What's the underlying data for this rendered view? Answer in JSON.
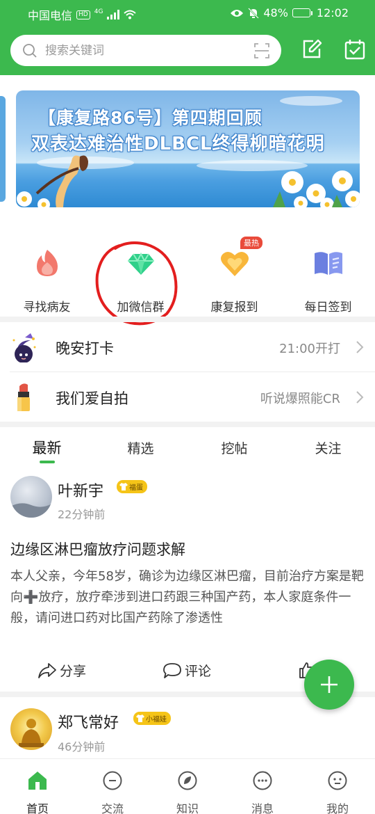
{
  "status_bar": {
    "carrier": "中国电信",
    "hd": "HD",
    "network": "4G",
    "battery": "48%",
    "battery_level": 0.48,
    "time": "12:02"
  },
  "header": {
    "search_placeholder": "搜索关键词",
    "icons": [
      "search-icon",
      "scan-icon",
      "edit-icon",
      "calendar-check-icon"
    ],
    "accent_color": "#3cb94e"
  },
  "banner": {
    "line1": "【康复路86号】第四期回顾",
    "line2": "双表达难治性DLBCL终得柳暗花明"
  },
  "quick_actions": [
    {
      "label": "寻找病友",
      "icon": "flame-icon"
    },
    {
      "label": "加微信群",
      "icon": "diamond-icon"
    },
    {
      "label": "康复报到",
      "icon": "heart-icon",
      "badge": "最热"
    },
    {
      "label": "每日签到",
      "icon": "book-icon"
    }
  ],
  "rows": [
    {
      "title": "晚安打卡",
      "value": "21:00开打",
      "icon": "moon-icon"
    },
    {
      "title": "我们爱自拍",
      "value": "听说爆照能CR",
      "icon": "lipstick-icon"
    }
  ],
  "tabs": [
    {
      "label": "最新",
      "active": true
    },
    {
      "label": "精选",
      "active": false
    },
    {
      "label": "挖帖",
      "active": false
    },
    {
      "label": "关注",
      "active": false
    }
  ],
  "posts": [
    {
      "author": "叶新宇",
      "badge": "福蛋",
      "time": "22分钟前",
      "title": "边缘区淋巴瘤放疗问题求解",
      "body": "本人父亲，今年58岁，确诊为边缘区淋巴瘤，目前治疗方案是靶向➕放疗，放疗牵涉到进口药跟三种国产药，本人家庭条件一般，请问进口药对比国产药除了渗透性",
      "actions": {
        "share": "分享",
        "comment": "评论"
      }
    },
    {
      "author": "郑飞常好",
      "badge": "小福娃",
      "time": "46分钟前"
    }
  ],
  "bottom_nav": [
    {
      "label": "首页",
      "icon": "home-icon",
      "active": true
    },
    {
      "label": "交流",
      "icon": "chat-circle-icon",
      "active": false
    },
    {
      "label": "知识",
      "icon": "leaf-icon",
      "active": false
    },
    {
      "label": "消息",
      "icon": "message-icon",
      "active": false
    },
    {
      "label": "我的",
      "icon": "profile-icon",
      "active": false
    }
  ]
}
